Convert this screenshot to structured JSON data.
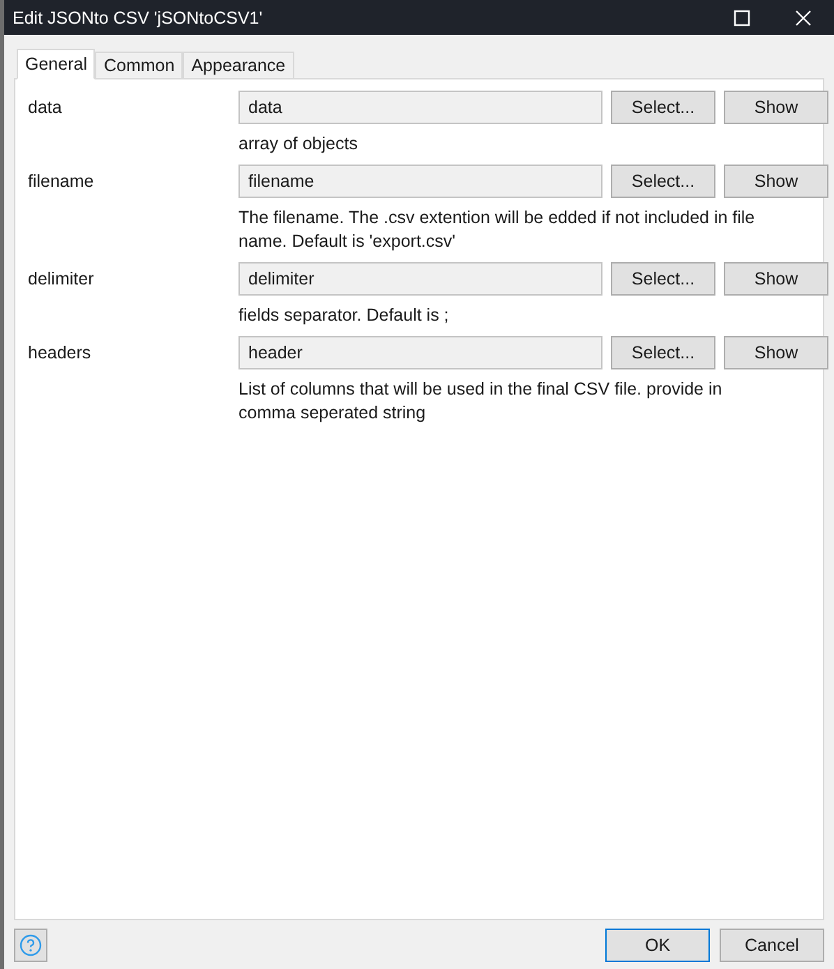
{
  "window": {
    "title": "Edit JSONto CSV 'jSONtoCSV1'"
  },
  "tabs": [
    {
      "label": "General",
      "selected": true
    },
    {
      "label": "Common",
      "selected": false
    },
    {
      "label": "Appearance",
      "selected": false
    }
  ],
  "properties": [
    {
      "label": "data",
      "value": "data",
      "select": "Select...",
      "show": "Show",
      "description": "array of objects"
    },
    {
      "label": "filename",
      "value": "filename",
      "select": "Select...",
      "show": "Show",
      "description": "The filename. The .csv extention will be edded if not included in file name. Default is 'export.csv'"
    },
    {
      "label": "delimiter",
      "value": "delimiter",
      "select": "Select...",
      "show": "Show",
      "description": "fields separator. Default is ;"
    },
    {
      "label": "headers",
      "value": "header",
      "select": "Select...",
      "show": "Show",
      "description": "List of columns that will be used in the final CSV file. provide in comma seperated string"
    }
  ],
  "buttons": [
    {
      "label": "OK",
      "kind": "default"
    },
    {
      "label": "Cancel",
      "kind": "normal"
    }
  ]
}
